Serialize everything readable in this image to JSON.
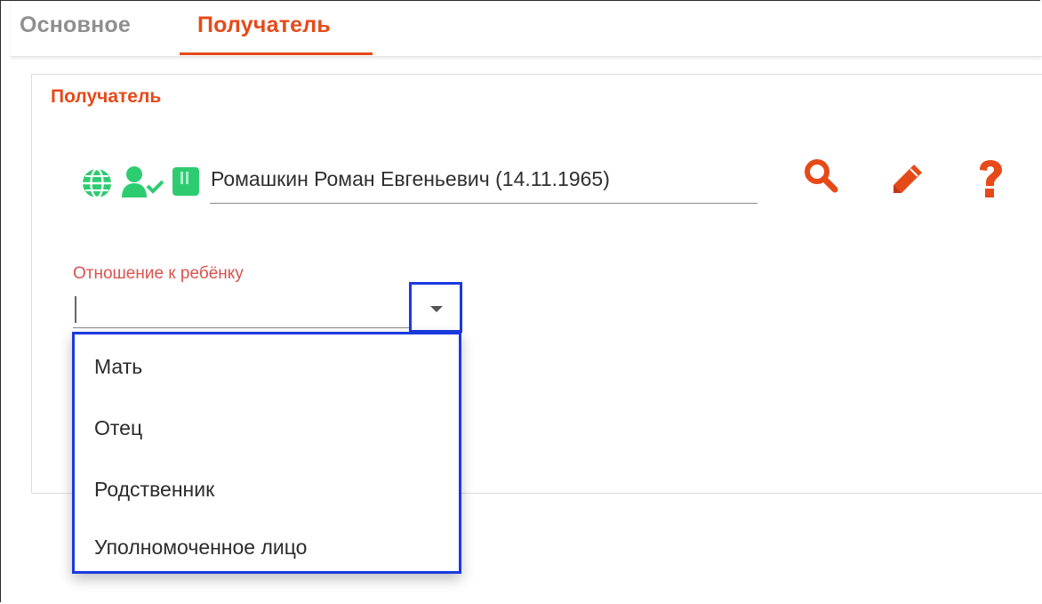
{
  "tabs": [
    {
      "label": "Основное",
      "active": false
    },
    {
      "label": "Получатель",
      "active": true
    }
  ],
  "section": {
    "title": "Получатель"
  },
  "recipient": {
    "status_icons": [
      "globe-icon",
      "user-check-icon",
      "card-icon"
    ],
    "value": "Ромашкин Роман Евгеньевич (14.11.1965)",
    "actions": [
      "search-icon",
      "pencil-icon",
      "question-icon"
    ]
  },
  "relation": {
    "label": "Отношение к ребёнку",
    "value": "",
    "options": [
      "Мать",
      "Отец",
      "Родственник",
      "Уполномоченное лицо"
    ]
  },
  "colors": {
    "accent": "#e64a19",
    "label_red": "#d9534f",
    "highlight_blue": "#1a3ae0",
    "icon_green": "#2ecc71"
  }
}
